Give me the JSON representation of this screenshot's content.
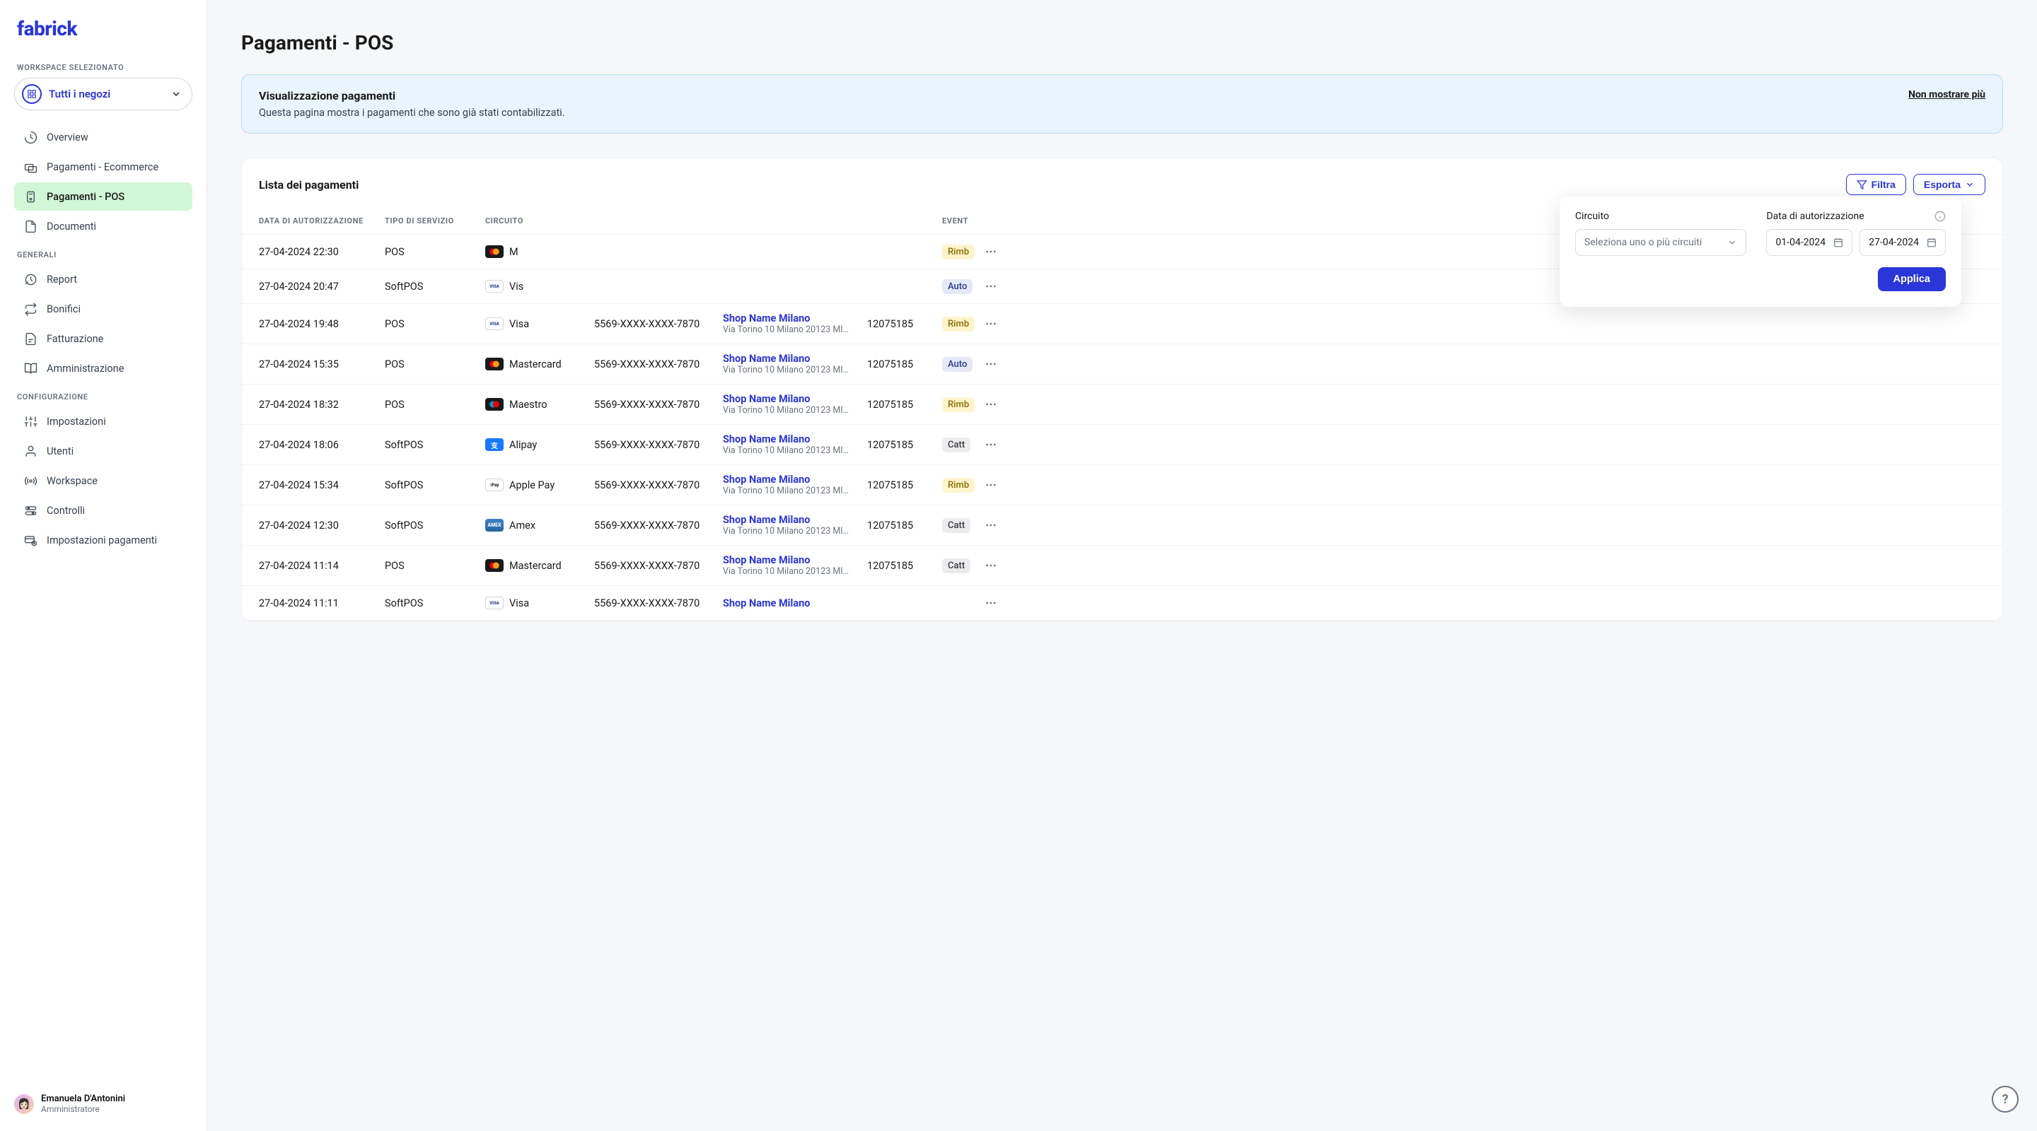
{
  "brand": "fabrick",
  "workspace": {
    "section_label": "WORKSPACE SELEZIONATO",
    "selector_label": "Tutti i negozi"
  },
  "nav": {
    "main": [
      {
        "label": "Overview",
        "icon": "clock"
      },
      {
        "label": "Pagamenti - Ecommerce",
        "icon": "cards"
      },
      {
        "label": "Pagamenti - POS",
        "icon": "pos",
        "active": true
      },
      {
        "label": "Documenti",
        "icon": "doc"
      }
    ],
    "generali_label": "GENERALI",
    "generali": [
      {
        "label": "Report",
        "icon": "report"
      },
      {
        "label": "Bonifici",
        "icon": "transfer"
      },
      {
        "label": "Fatturazione",
        "icon": "invoice"
      },
      {
        "label": "Amministrazione",
        "icon": "book"
      }
    ],
    "config_label": "CONFIGURAZIONE",
    "config": [
      {
        "label": "Impostazioni",
        "icon": "sliders"
      },
      {
        "label": "Utenti",
        "icon": "user"
      },
      {
        "label": "Workspace",
        "icon": "broadcast"
      },
      {
        "label": "Controlli",
        "icon": "toggles"
      },
      {
        "label": "Impostazioni pagamenti",
        "icon": "pay-settings"
      }
    ]
  },
  "user": {
    "name": "Emanuela D'Antonini",
    "role": "Amministratore"
  },
  "page": {
    "title": "Pagamenti - POS"
  },
  "banner": {
    "title": "Visualizzazione pagamenti",
    "text": "Questa pagina mostra i pagamenti che sono già stati contabilizzati.",
    "dismiss": "Non mostrare più"
  },
  "payments_card": {
    "title": "Lista dei pagamenti",
    "filter_button": "Filtra",
    "export_button": "Esporta",
    "columns": {
      "date": "DATA DI AUTORIZZAZIONE",
      "type": "TIPO DI SERVIZIO",
      "circuit": "CIRCUITO",
      "pan": "",
      "shop": "",
      "terminal": "",
      "event": "EVENT"
    },
    "rows": [
      {
        "date": "27-04-2024 22:30",
        "type": "POS",
        "circuit": "Mastercard",
        "circuit_short": "M",
        "badge": "mc",
        "pan": "",
        "shop_name": "",
        "shop_addr": "",
        "terminal": "",
        "event": "Rimb",
        "event_class": "rimb"
      },
      {
        "date": "27-04-2024 20:47",
        "type": "SoftPOS",
        "circuit": "Vis",
        "circuit_short": "Vis",
        "badge": "visa",
        "pan": "",
        "shop_name": "",
        "shop_addr": "",
        "terminal": "",
        "event": "Auto",
        "event_class": "auto"
      },
      {
        "date": "27-04-2024 19:48",
        "type": "POS",
        "circuit": "Visa",
        "badge": "visa",
        "pan": "5569-XXXX-XXXX-7870",
        "shop_name": "Shop Name Milano",
        "shop_addr": "Via Torino 10 Milano 20123 MI…",
        "terminal": "12075185",
        "event": "Rimb",
        "event_class": "rimb"
      },
      {
        "date": "27-04-2024 15:35",
        "type": "POS",
        "circuit": "Mastercard",
        "badge": "mc",
        "pan": "5569-XXXX-XXXX-7870",
        "shop_name": "Shop Name Milano",
        "shop_addr": "Via Torino 10 Milano 20123 MI…",
        "terminal": "12075185",
        "event": "Auto",
        "event_class": "auto"
      },
      {
        "date": "27-04-2024 18:32",
        "type": "POS",
        "circuit": "Maestro",
        "badge": "maestro",
        "pan": "5569-XXXX-XXXX-7870",
        "shop_name": "Shop Name Milano",
        "shop_addr": "Via Torino 10 Milano 20123 MI…",
        "terminal": "12075185",
        "event": "Rimb",
        "event_class": "rimb"
      },
      {
        "date": "27-04-2024 18:06",
        "type": "SoftPOS",
        "circuit": "Alipay",
        "badge": "alipay",
        "pan": "5569-XXXX-XXXX-7870",
        "shop_name": "Shop Name Milano",
        "shop_addr": "Via Torino 10 Milano 20123 MI…",
        "terminal": "12075185",
        "event": "Catt",
        "event_class": "catt"
      },
      {
        "date": "27-04-2024 15:34",
        "type": "SoftPOS",
        "circuit": "Apple Pay",
        "badge": "applepay",
        "pan": "5569-XXXX-XXXX-7870",
        "shop_name": "Shop Name Milano",
        "shop_addr": "Via Torino 10 Milano 20123 MI…",
        "terminal": "12075185",
        "event": "Rimb",
        "event_class": "rimb"
      },
      {
        "date": "27-04-2024 12:30",
        "type": "SoftPOS",
        "circuit": "Amex",
        "badge": "amex",
        "pan": "5569-XXXX-XXXX-7870",
        "shop_name": "Shop Name Milano",
        "shop_addr": "Via Torino 10 Milano 20123 MI…",
        "terminal": "12075185",
        "event": "Catt",
        "event_class": "catt"
      },
      {
        "date": "27-04-2024 11:14",
        "type": "POS",
        "circuit": "Mastercard",
        "badge": "mc",
        "pan": "5569-XXXX-XXXX-7870",
        "shop_name": "Shop Name Milano",
        "shop_addr": "Via Torino 10 Milano 20123 MI…",
        "terminal": "12075185",
        "event": "Catt",
        "event_class": "catt"
      },
      {
        "date": "27-04-2024 11:11",
        "type": "SoftPOS",
        "circuit": "Visa",
        "badge": "visa",
        "pan": "5569-XXXX-XXXX-7870",
        "shop_name": "Shop Name Milano",
        "shop_addr": "",
        "terminal": "",
        "event": "",
        "event_class": ""
      }
    ]
  },
  "filter_popover": {
    "circuit_label": "Circuito",
    "circuit_placeholder": "Seleziona uno o più circuiti",
    "date_label": "Data di autorizzazione",
    "date_from": "01-04-2024",
    "date_to": "27-04-2024",
    "apply": "Applica"
  },
  "help": "?"
}
